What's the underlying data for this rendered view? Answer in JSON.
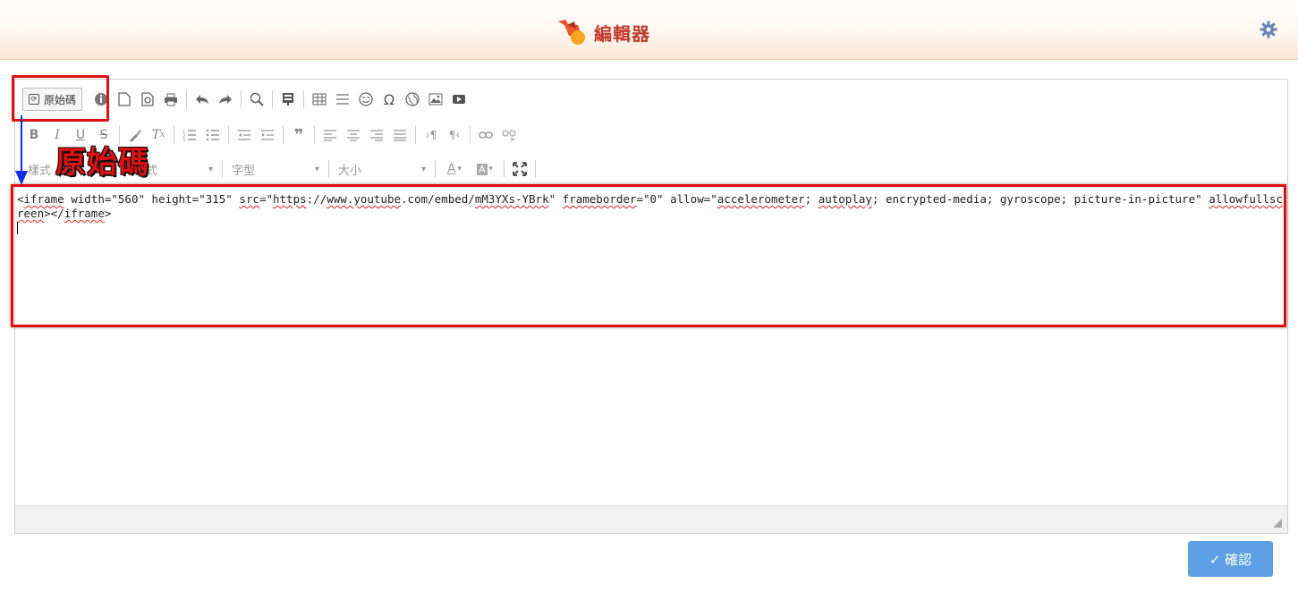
{
  "header": {
    "title": "編輯器"
  },
  "toolbar": {
    "source_label": "原始碼",
    "style_combo": "樣式",
    "format_combo": "格式",
    "font_combo": "字型",
    "size_combo": "大小"
  },
  "editor": {
    "code_tokens": [
      {
        "t": "<",
        "u": false
      },
      {
        "t": "iframe",
        "u": true
      },
      {
        "t": " width=\"560\" height=\"315\" ",
        "u": false
      },
      {
        "t": "src",
        "u": true
      },
      {
        "t": "=\"",
        "u": false
      },
      {
        "t": "https",
        "u": true
      },
      {
        "t": "://",
        "u": false
      },
      {
        "t": "www.youtube",
        "u": true
      },
      {
        "t": ".com/embed/",
        "u": false
      },
      {
        "t": "mM3YXs-YBrk",
        "u": true
      },
      {
        "t": "\" ",
        "u": false
      },
      {
        "t": "frameborder",
        "u": true
      },
      {
        "t": "=\"0\" allow=\"",
        "u": false
      },
      {
        "t": "accelerometer",
        "u": true
      },
      {
        "t": "; ",
        "u": false
      },
      {
        "t": "autoplay",
        "u": true
      },
      {
        "t": "; encrypted-media; gyroscope; picture-in-picture\" ",
        "u": false
      },
      {
        "t": "allowfullscreen",
        "u": true
      },
      {
        "t": "></",
        "u": false
      },
      {
        "t": "iframe",
        "u": true
      },
      {
        "t": ">",
        "u": false
      }
    ]
  },
  "annotation": {
    "label": "原始碼"
  },
  "footer": {
    "confirm_label": "✓ 確認"
  },
  "colors": {
    "accent": "#5da0e4",
    "highlight": "#e01010",
    "arrow": "#1030e0"
  }
}
